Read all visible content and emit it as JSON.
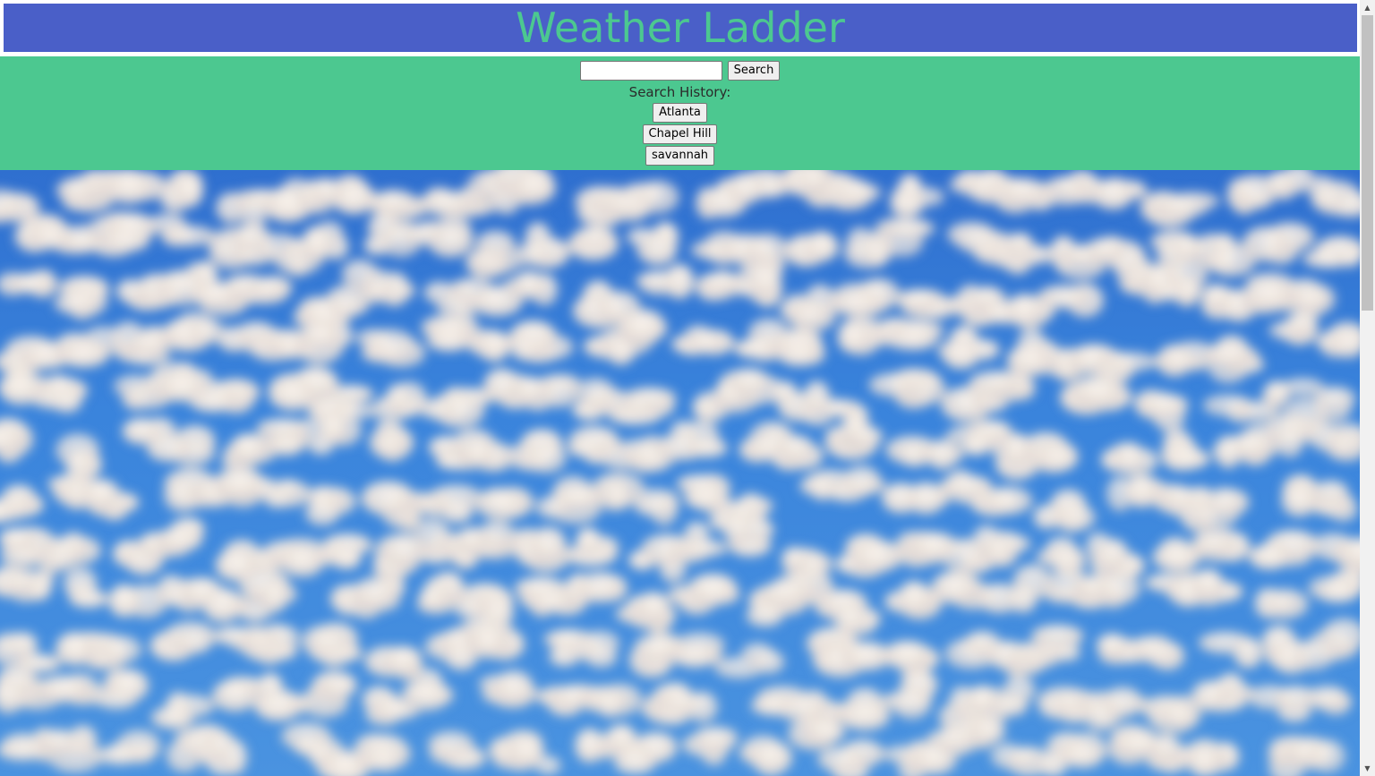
{
  "header": {
    "title": "Weather Ladder",
    "colors": {
      "bar": "#4a5fc8",
      "title": "#4cc890"
    }
  },
  "search": {
    "input_value": "",
    "input_placeholder": "",
    "button_label": "Search",
    "panel_color": "#4cc890"
  },
  "history": {
    "label": "Search History:",
    "items": [
      {
        "label": "Atlanta"
      },
      {
        "label": "Chapel Hill"
      },
      {
        "label": "savannah"
      }
    ]
  },
  "icons": {
    "scroll_up": "scroll-up-arrow-icon",
    "scroll_down": "scroll-down-arrow-icon"
  }
}
